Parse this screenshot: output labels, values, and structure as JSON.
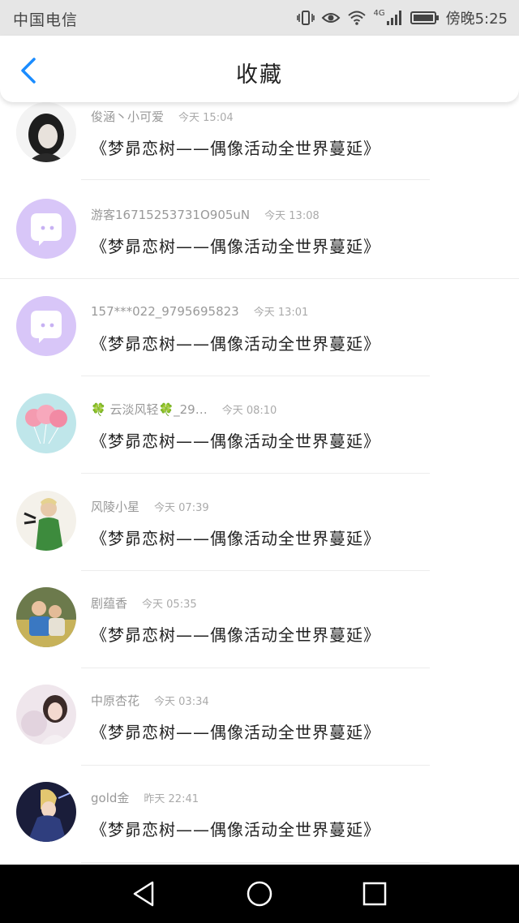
{
  "status_bar": {
    "carrier": "中国电信",
    "time": "傍晚5:25",
    "network": "4G",
    "icons": [
      "vibrate-icon",
      "eye-icon",
      "wifi-icon",
      "signal-icon",
      "battery-icon"
    ]
  },
  "header": {
    "title": "收藏",
    "back_icon": "chevron-left-icon"
  },
  "colors": {
    "accent": "#1a8cff",
    "avatar_default": "#d8c6f8",
    "system_nav": "#000000"
  },
  "favorites": [
    {
      "user": "俊涵丶小可爱",
      "time": "今天 15:04",
      "message": "《梦昴恋树——偶像活动全世界蔓延》",
      "avatar": "photo-girl-bw"
    },
    {
      "user": "游客16715253731О905uN",
      "time": "今天 13:08",
      "message": "《梦昴恋树——偶像活动全世界蔓延》",
      "avatar": "default-chat"
    },
    {
      "user": "157***022_9795695823",
      "time": "今天 13:01",
      "message": "《梦昴恋树——偶像活动全世界蔓延》",
      "avatar": "default-chat"
    },
    {
      "user": "🍀 云淡风轻🍀_29…",
      "time": "今天 08:10",
      "message": "《梦昴恋树——偶像活动全世界蔓延》",
      "avatar": "photo-balloons"
    },
    {
      "user": "风陵小星",
      "time": "今天 07:39",
      "message": "《梦昴恋树——偶像活动全世界蔓延》",
      "avatar": "photo-boy-green"
    },
    {
      "user": "剧蕴香",
      "time": "今天 05:35",
      "message": "《梦昴恋树——偶像活动全世界蔓延》",
      "avatar": "photo-kids"
    },
    {
      "user": "中原杏花",
      "time": "今天 03:34",
      "message": "《梦昴恋树——偶像活动全世界蔓延》",
      "avatar": "photo-girl-pastel"
    },
    {
      "user": "gold金",
      "time": "昨天 22:41",
      "message": "《梦昴恋树——偶像活动全世界蔓延》",
      "avatar": "photo-anime-dark"
    }
  ],
  "system_nav": {
    "back": "triangle-back-icon",
    "home": "circle-home-icon",
    "recents": "square-recents-icon"
  }
}
